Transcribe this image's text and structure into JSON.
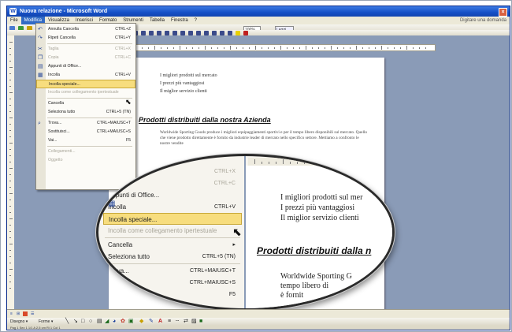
{
  "window": {
    "title": "Nuova relazione - Microsoft Word",
    "icon": "word-icon",
    "close": "close-icon"
  },
  "menubar": {
    "items": [
      "File",
      "Modifica",
      "Visualizza",
      "Inserisci",
      "Formato",
      "Strumenti",
      "Tabella",
      "Finestra",
      "?"
    ],
    "active_index": 1,
    "help_placeholder": "Digitare una domanda"
  },
  "toolbar": {
    "zoom": "100%",
    "font": "Times New Roman",
    "style": "Normale",
    "leggi": "Leggi"
  },
  "edit_menu": {
    "items": [
      {
        "label": "Annulla Cancella",
        "shortcut": "CTRL+Z",
        "icon": "undo-icon",
        "disabled": false
      },
      {
        "label": "Ripeti Cancella",
        "shortcut": "CTRL+Y",
        "icon": "redo-icon",
        "disabled": false
      },
      {
        "separator": true
      },
      {
        "label": "Taglia",
        "shortcut": "CTRL+X",
        "icon": "scissors-icon",
        "disabled": true
      },
      {
        "label": "Copia",
        "shortcut": "CTRL+C",
        "icon": "copy-icon",
        "disabled": true
      },
      {
        "label": "Appunti di Office...",
        "shortcut": "",
        "icon": "clipboard-icon",
        "disabled": false
      },
      {
        "label": "Incolla",
        "shortcut": "CTRL+V",
        "icon": "paste-icon",
        "disabled": false
      },
      {
        "label": "Incolla speciale...",
        "shortcut": "",
        "icon": "",
        "disabled": false,
        "highlighted": true
      },
      {
        "label": "Incolla come collegamento ipertestuale",
        "shortcut": "",
        "icon": "",
        "disabled": true
      },
      {
        "separator": true
      },
      {
        "label": "Cancella",
        "shortcut": "▸",
        "icon": "",
        "disabled": false
      },
      {
        "label": "Seleziona tutto",
        "shortcut": "CTRL+5 (TN)",
        "icon": "",
        "disabled": false
      },
      {
        "separator": true
      },
      {
        "label": "Trova...",
        "shortcut": "CTRL+MAIUSC+T",
        "icon": "binoculars-icon",
        "disabled": false
      },
      {
        "label": "Sostituisci...",
        "shortcut": "CTRL+MAIUSC+S",
        "icon": "",
        "disabled": false
      },
      {
        "label": "Vai...",
        "shortcut": "F5",
        "icon": "",
        "disabled": false
      },
      {
        "separator": true
      },
      {
        "label": "Collegamenti...",
        "shortcut": "",
        "icon": "",
        "disabled": true
      },
      {
        "label": "Oggetto",
        "shortcut": "",
        "icon": "",
        "disabled": true
      }
    ]
  },
  "document": {
    "lines": [
      "I migliori prodotti sul mercato",
      "I prezzi più vantaggiosi",
      "Il miglior servizio clienti"
    ],
    "heading": "Prodotti distribuiti dalla nostra Azienda",
    "paragraph": "Worldwide Sporting Goods produce i migliori equipaggiamenti sportivi e per il tempo libero disponibili sul mercato. Quello che viene prodotto direttamente è fornito da industrie leader di mercato nello specifico settore. Mettiamo a confronto le nostre vendite"
  },
  "magnifier": {
    "menu": [
      {
        "label": "",
        "shortcut": "CTRL+X",
        "disabled": true
      },
      {
        "label": "",
        "shortcut": "CTRL+C",
        "disabled": true
      },
      {
        "label": "Appunti di Office...",
        "shortcut": "",
        "disabled": false
      },
      {
        "label": "Incolla",
        "shortcut": "CTRL+V",
        "disabled": false
      },
      {
        "label": "Incolla speciale...",
        "shortcut": "",
        "disabled": false,
        "highlighted": true
      },
      {
        "label": "Incolla come collegamento ipertestuale",
        "shortcut": "",
        "disabled": true
      },
      {
        "label": "Cancella",
        "shortcut": "▸",
        "disabled": false
      },
      {
        "label": "Seleziona tutto",
        "shortcut": "CTRL+5 (TN)",
        "disabled": false
      },
      {
        "label": "Trova...",
        "shortcut": "CTRL+MAIUSC+T",
        "disabled": false
      },
      {
        "label": "",
        "shortcut": "CTRL+MAIUSC+S",
        "disabled": false
      },
      {
        "label": "",
        "shortcut": "F5",
        "disabled": false
      }
    ],
    "doc_lines": [
      "I migliori prodotti sul mer",
      "I prezzi più vantaggiosi",
      "Il miglior servizio clienti"
    ],
    "heading": "Prodotti distribuiti dalla n",
    "para_lines": [
      "Worldwide Sporting G",
      "tempo libero di",
      "è fornit"
    ]
  },
  "drawing_toolbar": {
    "disegno": "Disegno ▾",
    "forme": "Forme ▾"
  },
  "statusbar": {
    "text": "Pag 1   Sez 1   1/1   A 2,5 cm   Ri 1   Col 1"
  }
}
